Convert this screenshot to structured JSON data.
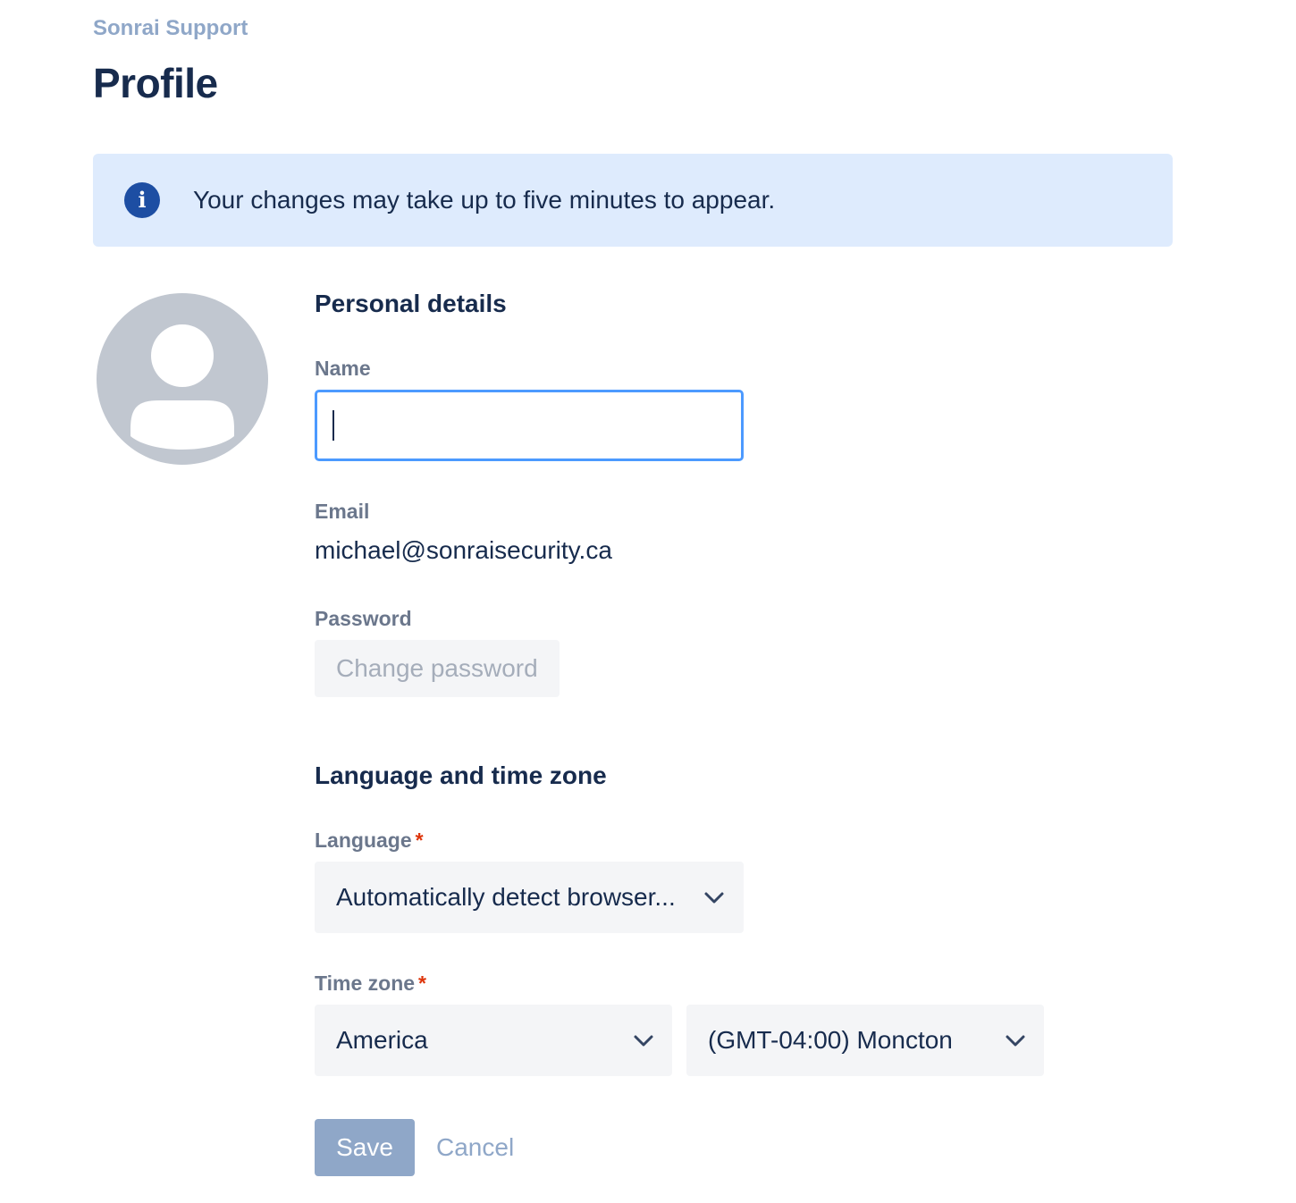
{
  "breadcrumb": "Sonrai Support",
  "page_title": "Profile",
  "banner": {
    "icon": "info-icon",
    "text": "Your changes may take up to five minutes to appear."
  },
  "avatar": {
    "icon": "default-user-avatar"
  },
  "personal_details": {
    "heading": "Personal details",
    "name_label": "Name",
    "name_value": "",
    "email_label": "Email",
    "email_value": "michael@sonraisecurity.ca",
    "password_label": "Password",
    "change_password_label": "Change password"
  },
  "language_timezone": {
    "heading": "Language and time zone",
    "language_label": "Language",
    "language_value": "Automatically detect browser...",
    "required_marker": "*",
    "timezone_label": "Time zone",
    "region_value": "America",
    "zone_value": "(GMT-04:00) Moncton"
  },
  "actions": {
    "save_label": "Save",
    "cancel_label": "Cancel"
  },
  "colors": {
    "primary_text": "#172b4d",
    "muted_label": "#6b778c",
    "banner_bg": "#deebfd",
    "info_icon": "#1d4ea3",
    "focus_border": "#4c9aff",
    "disabled_button": "#8fa7c8",
    "required": "#de350b"
  }
}
